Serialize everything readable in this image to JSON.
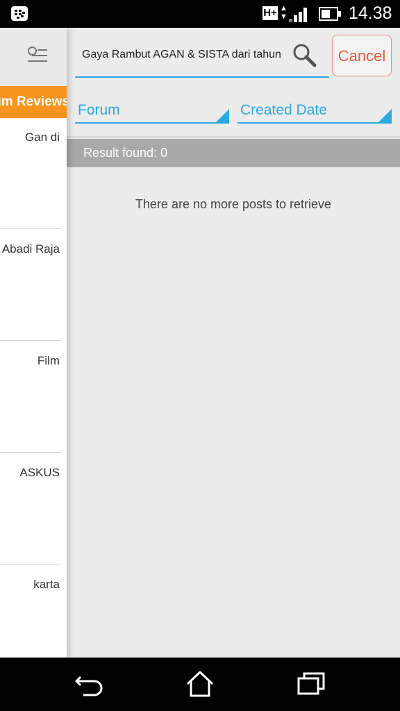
{
  "status_bar": {
    "network_type": "H+",
    "time": "14.38",
    "icons": [
      "blackberry-messenger-icon",
      "network-arrows-icon",
      "signal-icon",
      "battery-icon"
    ]
  },
  "drawer": {
    "tab_label": "Forum Reviews",
    "items": [
      {
        "label": "Gan di"
      },
      {
        "label": "Abadi Raja"
      },
      {
        "label": "Film"
      },
      {
        "label": "ASKUS"
      },
      {
        "label": "karta"
      }
    ]
  },
  "search": {
    "query": "Gaya Rambut AGAN & SISTA dari tahun",
    "cancel_label": "Cancel"
  },
  "filters": {
    "forum_label": "Forum",
    "date_label": "Created Date"
  },
  "results": {
    "count_text": "Result found: 0",
    "empty_message": "There are no more posts to retrieve"
  },
  "colors": {
    "accent": "#29a9e0",
    "tab": "#f7941d",
    "cancel": "#e45a3e"
  }
}
